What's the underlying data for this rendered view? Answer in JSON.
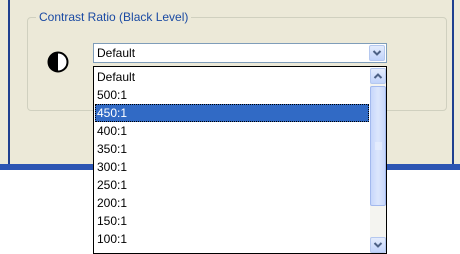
{
  "group": {
    "title": "Contrast Ratio (Black Level)"
  },
  "combo": {
    "value": "Default"
  },
  "dropdown": {
    "options": [
      "Default",
      "500:1",
      "450:1",
      "400:1",
      "350:1",
      "300:1",
      "250:1",
      "200:1",
      "150:1",
      "100:1"
    ],
    "selected_index": 2
  },
  "icons": {
    "contrast": "contrast-icon",
    "dropdown_arrow": "chevron-down-icon",
    "scroll_up": "chevron-up-icon",
    "scroll_down": "chevron-down-icon"
  },
  "colors": {
    "selection": "#316ac5",
    "legend_text": "#1a4aa3",
    "panel_bg": "#ece9d8"
  }
}
